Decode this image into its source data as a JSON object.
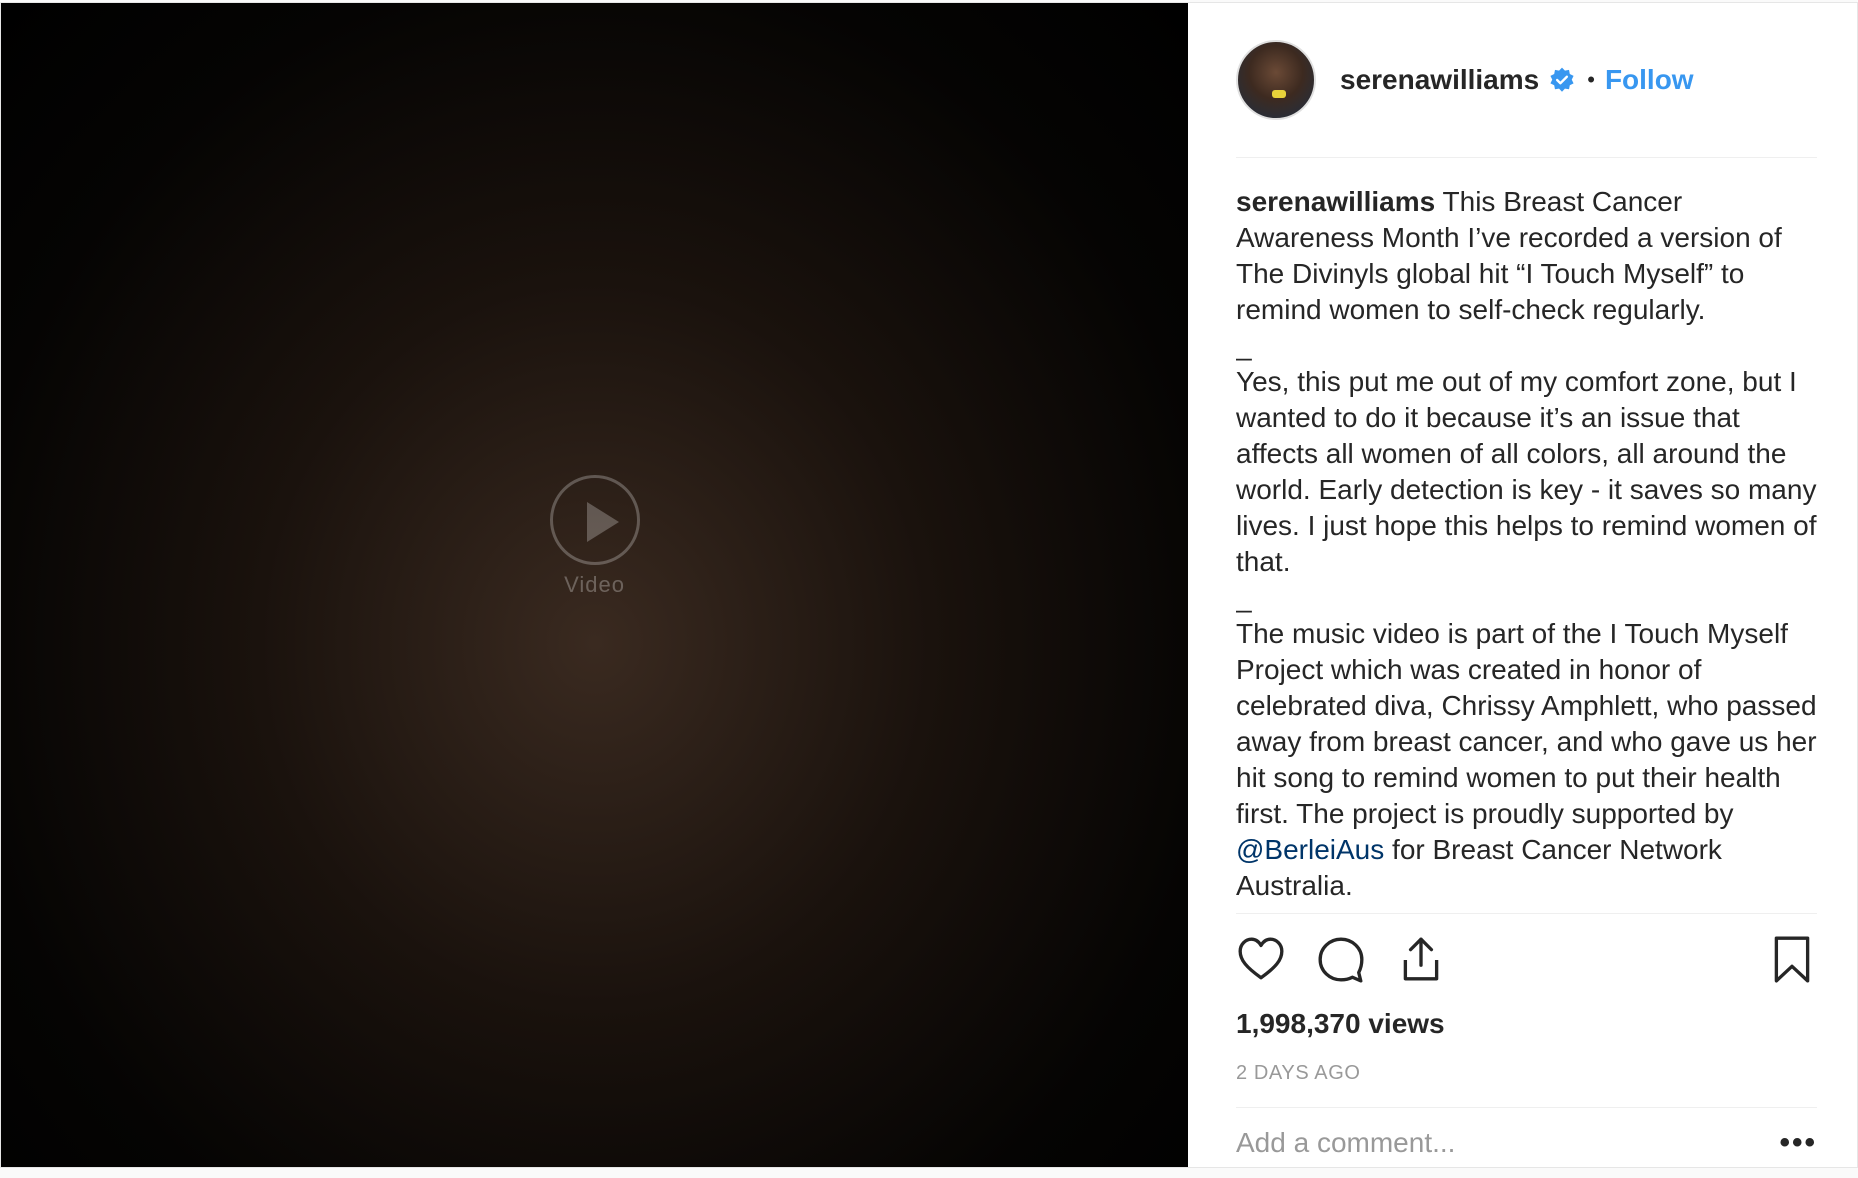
{
  "media": {
    "placeholder": "Video"
  },
  "header": {
    "username": "serenawilliams",
    "separator": "•",
    "follow_label": "Follow"
  },
  "caption": {
    "author": "serenawilliams",
    "paragraph1": "This Breast Cancer Awareness Month I’ve recorded a version of The Divinyls global hit “I Touch Myself” to remind women to self-check regularly.",
    "sep1": "_",
    "paragraph2": "Yes, this put me out of my comfort zone, but I wanted to do it because it’s an issue that affects all women of all colors, all around the world. Early detection is key - it saves so many lives. I just hope this helps to remind women of that.",
    "sep2": "_",
    "paragraph3_before": "The music video is part of the I Touch Myself Project which was created in honor of celebrated diva, Chrissy Amphlett, who passed away from breast cancer, and who gave us her hit song to remind women to put their health first. The project is proudly supported by",
    "mention": "@BerleiAus",
    "paragraph3_after": "for Breast Cancer Network Australia."
  },
  "stats": {
    "views": "1,998,370 views",
    "time": "2 DAYS AGO"
  },
  "comment": {
    "placeholder": "Add a comment...",
    "more": "•••"
  },
  "colors": {
    "link": "#3897f0",
    "verified": "#3897f0",
    "text": "#262626",
    "muted": "#999999"
  }
}
